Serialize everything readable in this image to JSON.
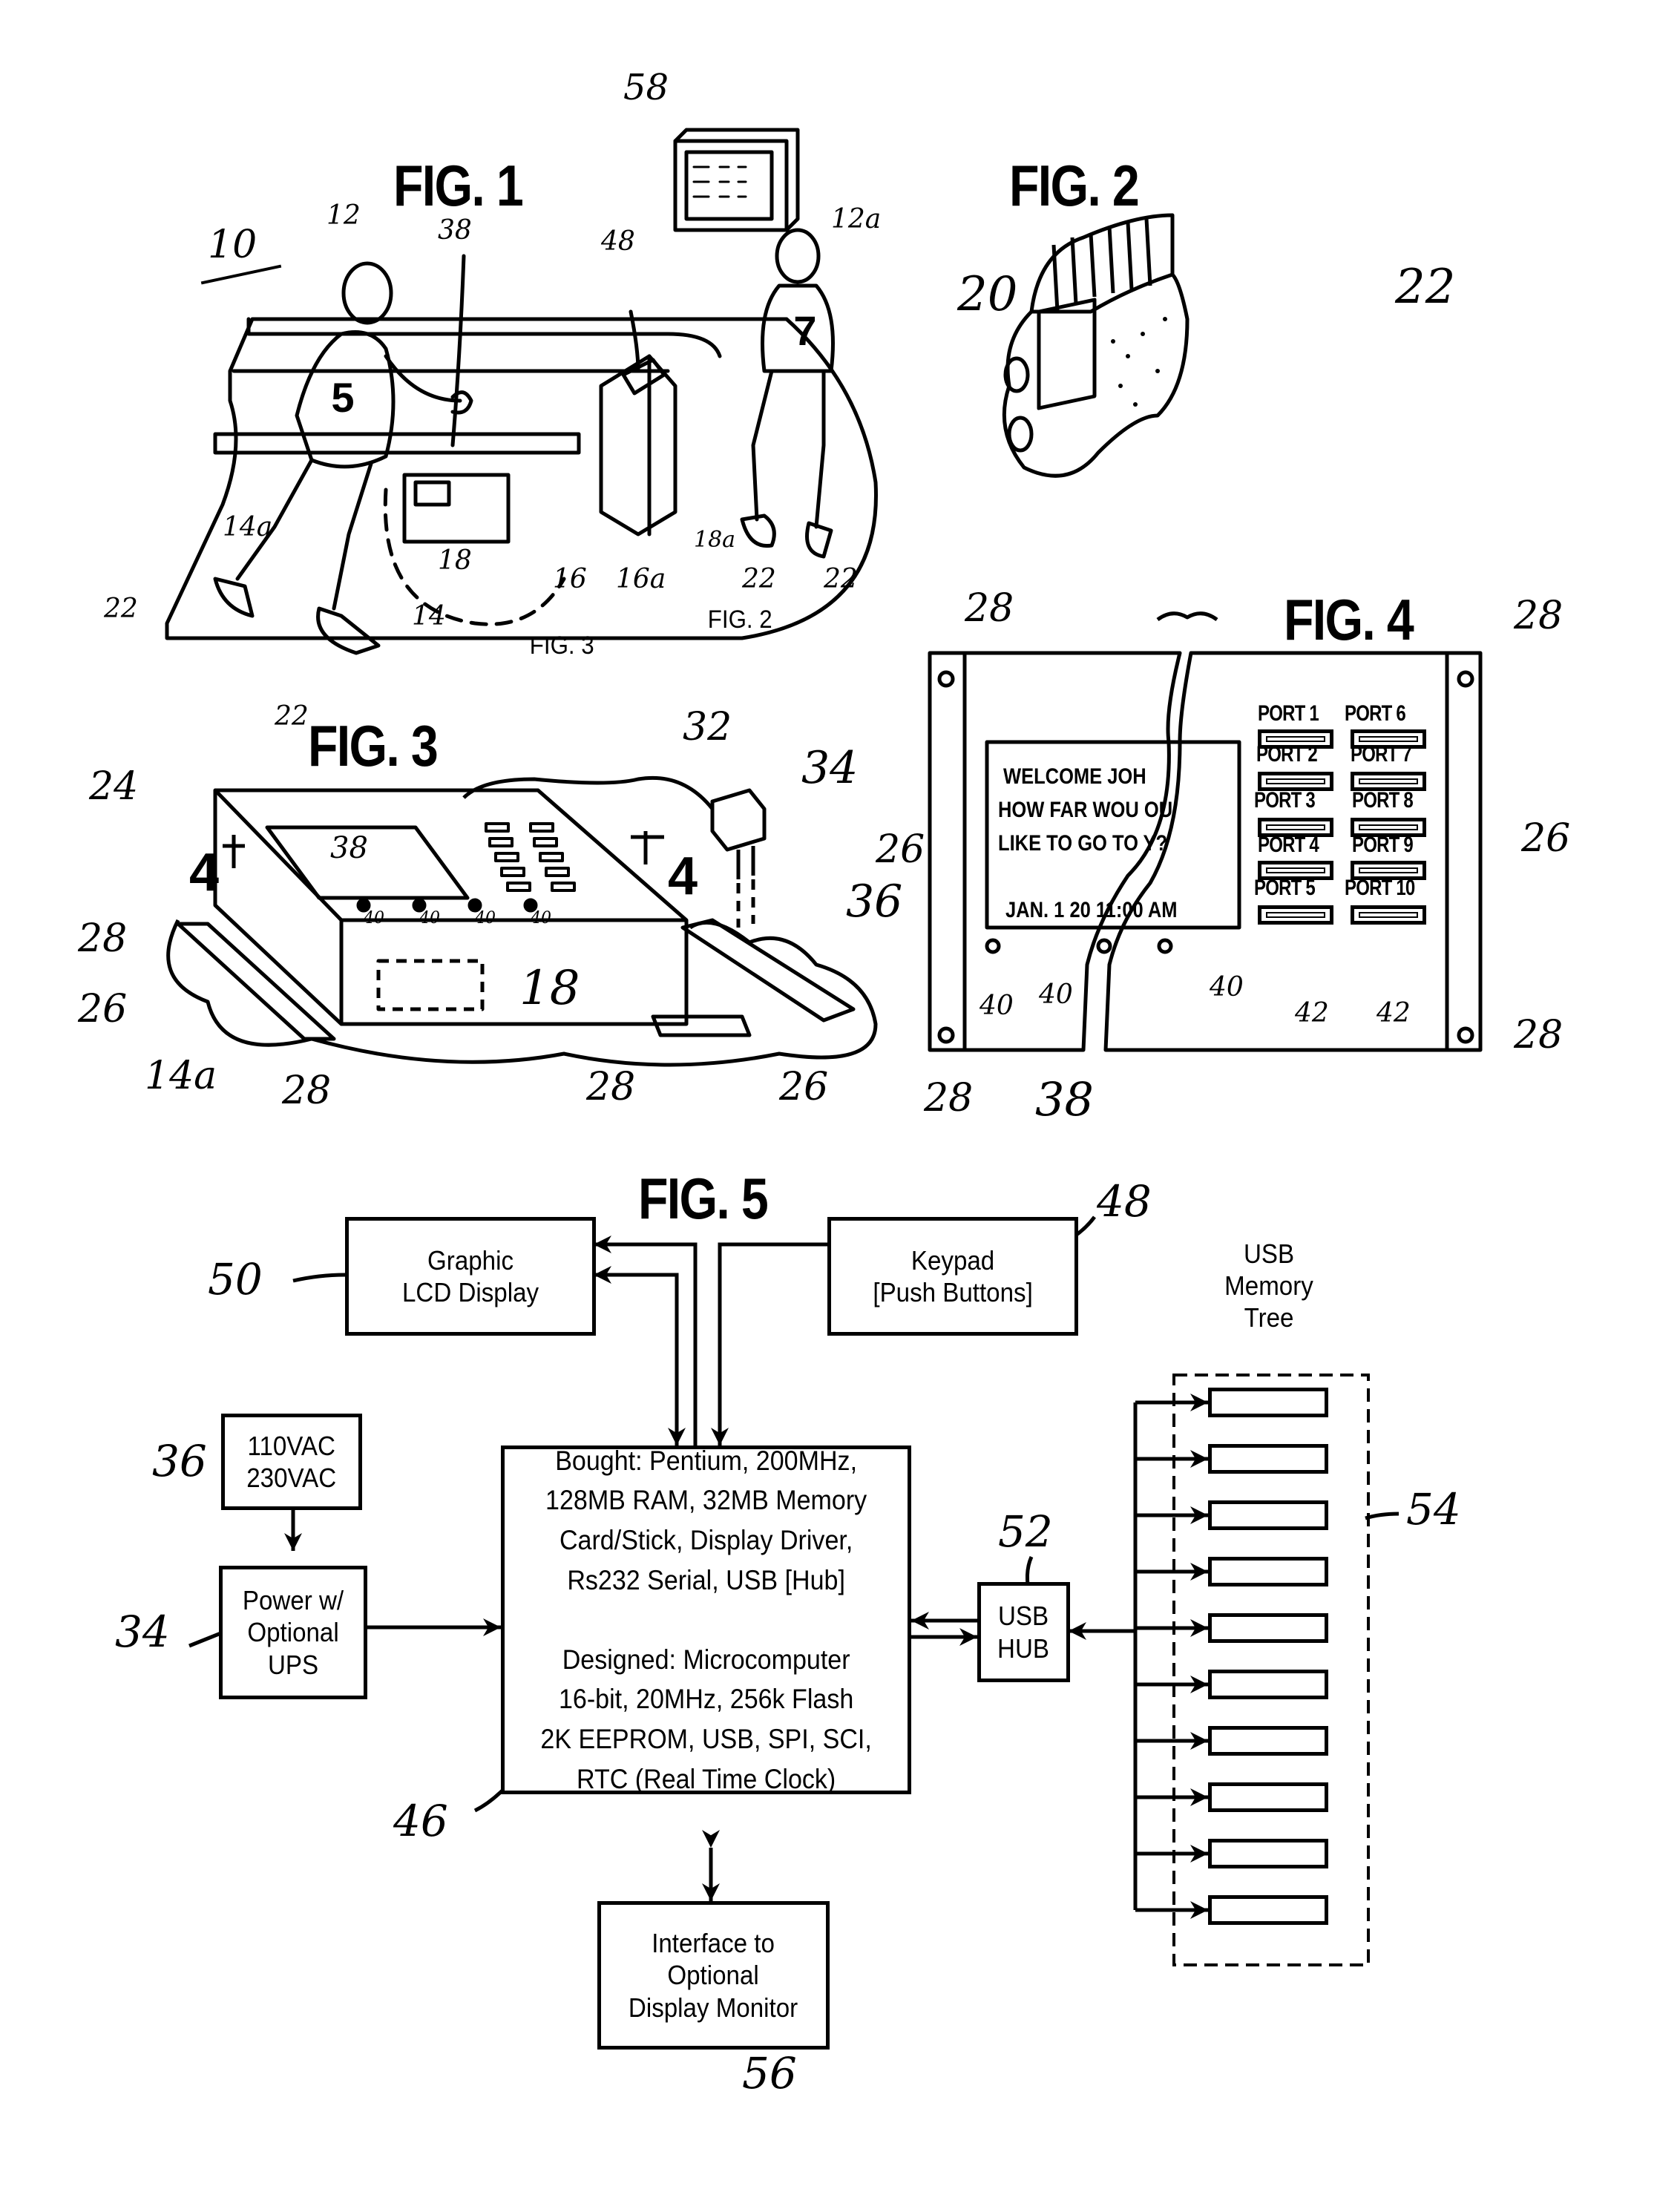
{
  "sheet": {
    "figures": {
      "fig1": {
        "title": "FIG. 1",
        "ref_labels": [
          "10",
          "12",
          "12a",
          "38",
          "48",
          "58",
          "14",
          "14a",
          "18",
          "18a",
          "16",
          "16a",
          "22",
          "22",
          "22",
          "22",
          "22"
        ],
        "callouts": [
          "FIG. 3",
          "FIG. 2"
        ],
        "jersey_numbers": [
          "5",
          "7"
        ]
      },
      "fig2": {
        "title": "FIG. 2",
        "ref_labels": [
          "20",
          "22"
        ]
      },
      "fig3": {
        "title": "FIG. 3",
        "section_marks": [
          "4",
          "4"
        ],
        "ref_labels": [
          "24",
          "28",
          "26",
          "14a",
          "28",
          "38",
          "40",
          "40",
          "40",
          "40",
          "18",
          "32",
          "34",
          "36",
          "28",
          "26"
        ]
      },
      "fig4": {
        "title": "FIG. 4",
        "lcd_lines": [
          "WELCOME JOH",
          "HOW FAR WOU  OU",
          "LIKE TO GO TO   Y?",
          "JAN. 1 20   11:00 AM"
        ],
        "ports_left": [
          "PORT 1",
          "PORT 2",
          "PORT 3",
          "PORT 4",
          "PORT 5"
        ],
        "ports_right": [
          "PORT 6",
          "PORT 7",
          "PORT 8",
          "PORT 9",
          "PORT 10"
        ],
        "ref_labels": [
          "28",
          "28",
          "28",
          "28",
          "26",
          "26",
          "40",
          "40",
          "40",
          "40",
          "42",
          "42",
          "38"
        ]
      },
      "fig5": {
        "title": "FIG. 5",
        "blocks": {
          "lcd": {
            "label": "Graphic\nLCD Display",
            "ref": "50"
          },
          "keypad": {
            "label": "Keypad\n[Push Buttons]",
            "ref": "48"
          },
          "vac": {
            "label": "110VAC\n230VAC",
            "ref": "36"
          },
          "power": {
            "label": "Power w/\nOptional\nUPS",
            "ref": "34"
          },
          "cpu": {
            "label": "Bought:  Pentium, 200MHz,\n128MB RAM, 32MB Memory\nCard/Stick, Display Driver,\nRs232 Serial, USB [Hub]\n\nDesigned:  Microcomputer\n16-bit, 20MHz, 256k Flash\n2K EEPROM, USB, SPI, SCI,\nRTC (Real Time Clock)",
            "ref": "46"
          },
          "hub": {
            "label": "USB\nHUB",
            "ref": "52"
          },
          "memory_tree": {
            "label": "USB\nMemory\nTree",
            "ref": "54",
            "stick_count": 10
          },
          "monitor": {
            "label": "Interface to\nOptional\nDisplay Monitor",
            "ref": "56"
          }
        }
      }
    }
  }
}
